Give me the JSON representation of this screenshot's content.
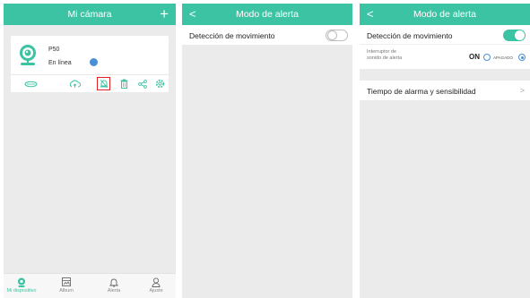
{
  "screen1": {
    "header_title": "Mi cámara",
    "add_icon": "plus-icon",
    "device": {
      "name": "P50",
      "status": "En línea",
      "status_icon": "online-indicator-icon",
      "actions": [
        "cloud-storage-icon",
        "cloud-upload-icon",
        "alert-mode-icon",
        "delete-icon",
        "share-icon",
        "settings-icon"
      ],
      "selected_action": "alert-mode-icon"
    },
    "nav": [
      {
        "label": "Mi dispositivo",
        "icon": "device-icon",
        "active": true
      },
      {
        "label": "Album",
        "icon": "album-icon",
        "active": false
      },
      {
        "label": "Alerta",
        "icon": "bell-icon",
        "active": false
      },
      {
        "label": "Ajuste",
        "icon": "user-icon",
        "active": false
      }
    ]
  },
  "screen2": {
    "header_title": "Modo de alerta",
    "motion_detection_label": "Detección de movimiento",
    "motion_detection_on": false
  },
  "screen3": {
    "header_title": "Modo de alerta",
    "motion_detection_label": "Detección de movimiento",
    "motion_detection_on": true,
    "sound_switch_label_line1": "Interruptor de",
    "sound_switch_label_line2": "sonido de alerta",
    "sound_on_label": "ON",
    "sound_off_label": "APAGADO",
    "sound_selected": "APAGADO",
    "alarm_time_label": "Tiempo de alarma y sensibilidad"
  },
  "colors": {
    "accent": "#3cc3a3",
    "link": "#4a90d9",
    "background": "#ebebeb"
  }
}
